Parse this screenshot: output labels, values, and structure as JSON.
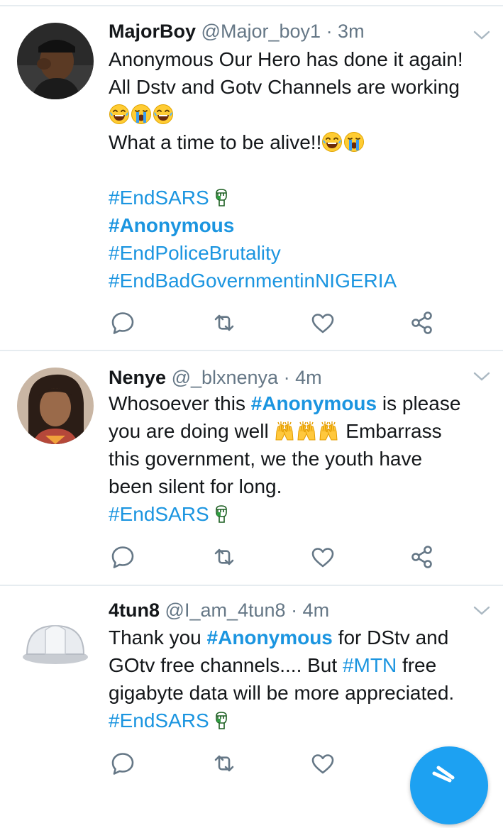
{
  "tweets": [
    {
      "name": "MajorBoy",
      "handle": "@Major_boy1",
      "time": "· 3m",
      "avatar": "avatar-photo-man-cap",
      "lines": {
        "l1": "Anonymous Our Hero has done it again!",
        "l2": "All Dstv and Gotv Channels are working",
        "l4": "What a time to be alive!!"
      },
      "emojis": [
        "joy-emoji",
        "crying-emoji",
        "joy-emoji"
      ],
      "hashtags": [
        "#EndSARS",
        "#Anonymous",
        "#EndPoliceBrutality",
        "#EndBadGovernmentinNIGERIA"
      ]
    },
    {
      "name": "Nenye",
      "handle": "@_blxnenya",
      "time": "· 4m",
      "avatar": "avatar-photo-woman",
      "lines": {
        "l1_pre": "Whosoever this ",
        "l1_tag": "#Anonymous",
        "l1_post": " is please",
        "l2_pre": "you are doing well ",
        "l2_post": " Embarrass",
        "l3": "this government, we the youth have",
        "l4": "been silent for long.",
        "tag": "#EndSARS"
      },
      "emojis": [
        "raising-hands-emoji",
        "raising-hands-emoji",
        "raising-hands-emoji"
      ]
    },
    {
      "name": "4tun8",
      "handle": "@I_am_4tun8",
      "time": "· 4m",
      "avatar": "avatar-hard-hat",
      "lines": {
        "l1_pre": "Thank you ",
        "l1_tag": "#Anonymous",
        "l1_post": " for DStv and",
        "l2_pre": "GOtv free channels.... But ",
        "l2_tag": "#MTN",
        "l2_post": " free",
        "l3": "gigabyte data will be more appreciated.",
        "tag": "#EndSARS"
      }
    }
  ],
  "actions": [
    "reply-icon",
    "retweet-icon",
    "like-icon",
    "share-icon"
  ],
  "colors": {
    "link": "#1b95e0",
    "muted": "#657786",
    "divider": "#e6ecf0",
    "fab": "#1da1f2"
  }
}
